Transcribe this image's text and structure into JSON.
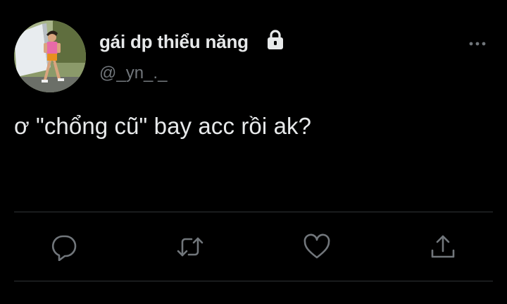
{
  "user": {
    "display_name": "gái dp thiểu năng",
    "handle": "@_yn_._",
    "protected_icon": "lock-icon"
  },
  "tweet": {
    "text": "ơ \"chổng cũ\" bay acc rồi ak?"
  },
  "actions": [
    {
      "name": "reply",
      "icon": "reply-icon"
    },
    {
      "name": "retweet",
      "icon": "retweet-icon"
    },
    {
      "name": "like",
      "icon": "heart-icon"
    },
    {
      "name": "share",
      "icon": "share-icon"
    }
  ],
  "menu": {
    "icon": "more-icon"
  },
  "colors": {
    "background": "#000000",
    "primary_text": "#e7e9ea",
    "secondary_text": "#71767b",
    "divider": "#2f3336",
    "icon": "#71767b"
  }
}
